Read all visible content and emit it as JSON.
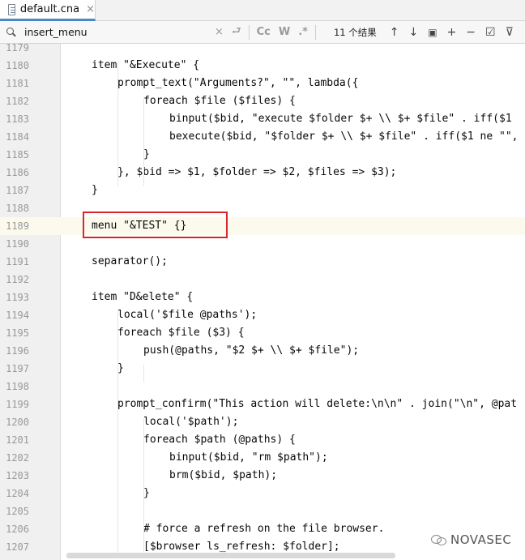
{
  "tab": {
    "file_name": "default.cna",
    "close_glyph": "×"
  },
  "search": {
    "query": "insert_menu",
    "clear_glyph": "×",
    "history_glyph": "⮐",
    "case_label": "Cc",
    "word_label": "W",
    "regex_label": ".*",
    "match_count": "11 个结果",
    "prev_glyph": "↑",
    "next_glyph": "↓",
    "select_all_glyph": "▣",
    "add_cursor_glyph": "+",
    "remove_cursor_glyph": "−",
    "select_all_occ_glyph": "☑",
    "filter_glyph": "⊽"
  },
  "editor": {
    "highlight_color": "#fcfaed",
    "annotation_color": "#d9252c",
    "lines": [
      {
        "num": "1179",
        "indent": 0,
        "text": ""
      },
      {
        "num": "1180",
        "indent": 1,
        "text": "item \"&Execute\" {"
      },
      {
        "num": "1181",
        "indent": 2,
        "text": "prompt_text(\"Arguments?\", \"\", lambda({"
      },
      {
        "num": "1182",
        "indent": 3,
        "text": "foreach $file ($files) {"
      },
      {
        "num": "1183",
        "indent": 4,
        "text": "binput($bid, \"execute $folder $+ \\\\ $+ $file\" . iff($1"
      },
      {
        "num": "1184",
        "indent": 4,
        "text": "bexecute($bid, \"$folder $+ \\\\ $+ $file\" . iff($1 ne \"\","
      },
      {
        "num": "1185",
        "indent": 3,
        "text": "}"
      },
      {
        "num": "1186",
        "indent": 2,
        "text": "}, $bid => $1, $folder => $2, $files => $3);"
      },
      {
        "num": "1187",
        "indent": 1,
        "text": "}"
      },
      {
        "num": "1188",
        "indent": 0,
        "text": ""
      },
      {
        "num": "1189",
        "indent": 1,
        "text": "menu \"&TEST\" {}"
      },
      {
        "num": "1190",
        "indent": 0,
        "text": ""
      },
      {
        "num": "1191",
        "indent": 1,
        "text": "separator();"
      },
      {
        "num": "1192",
        "indent": 0,
        "text": ""
      },
      {
        "num": "1193",
        "indent": 1,
        "text": "item \"D&elete\" {"
      },
      {
        "num": "1194",
        "indent": 2,
        "text": "local('$file @paths');"
      },
      {
        "num": "1195",
        "indent": 2,
        "text": "foreach $file ($3) {"
      },
      {
        "num": "1196",
        "indent": 3,
        "text": "push(@paths, \"$2 $+ \\\\ $+ $file\");"
      },
      {
        "num": "1197",
        "indent": 2,
        "text": "}"
      },
      {
        "num": "1198",
        "indent": 0,
        "text": ""
      },
      {
        "num": "1199",
        "indent": 2,
        "text": "prompt_confirm(\"This action will delete:\\n\\n\" . join(\"\\n\", @pat"
      },
      {
        "num": "1200",
        "indent": 3,
        "text": "local('$path');"
      },
      {
        "num": "1201",
        "indent": 3,
        "text": "foreach $path (@paths) {"
      },
      {
        "num": "1202",
        "indent": 4,
        "text": "binput($bid, \"rm $path\");"
      },
      {
        "num": "1203",
        "indent": 4,
        "text": "brm($bid, $path);"
      },
      {
        "num": "1204",
        "indent": 3,
        "text": "}"
      },
      {
        "num": "1205",
        "indent": 0,
        "text": ""
      },
      {
        "num": "1206",
        "indent": 3,
        "text": "# force a refresh on the file browser."
      },
      {
        "num": "1207",
        "indent": 3,
        "text": "[$browser ls_refresh: $folder];"
      }
    ]
  },
  "watermark": {
    "text": "NOVASEC"
  }
}
